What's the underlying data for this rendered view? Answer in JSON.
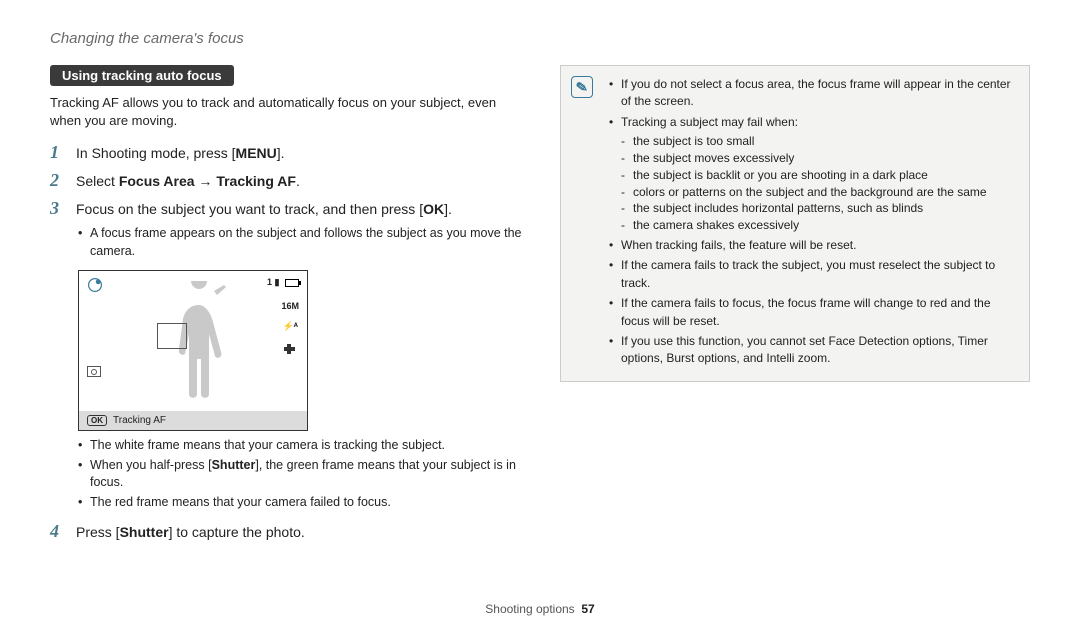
{
  "header": "Changing the camera's focus",
  "section_badge": "Using tracking auto focus",
  "intro": "Tracking AF allows you to track and automatically focus on your subject, even when you are moving.",
  "steps": {
    "s1": {
      "num": "1",
      "pre": "In Shooting mode, press [",
      "btn": "MENU",
      "post": "]."
    },
    "s2": {
      "num": "2",
      "pre": "Select ",
      "bold1": "Focus Area",
      "arrow": " → ",
      "bold2": "Tracking AF",
      "post": "."
    },
    "s3": {
      "num": "3",
      "pre": "Focus on the subject you want to track, and then press [",
      "btn": "OK",
      "post": "].",
      "sub": "A focus frame appears on the subject and follows the subject as you move the camera."
    },
    "s4": {
      "num": "4",
      "pre": "Press [",
      "bold": "Shutter",
      "post": "] to capture the photo."
    }
  },
  "lcd": {
    "counter": "1",
    "res": "16M",
    "flash": "⚡ᴬ",
    "bar_label": "Tracking AF",
    "bar_btn": "OK"
  },
  "frames": {
    "f1": "The white frame means that your camera is tracking the subject.",
    "f2_pre": "When you half-press [",
    "f2_bold": "Shutter",
    "f2_post": "], the green frame means that your subject is in focus.",
    "f3": "The red frame means that your camera failed to focus."
  },
  "note": {
    "n1": "If you do not select a focus area, the focus frame will appear in the center of the screen.",
    "n2": "Tracking a subject may fail when:",
    "n2subs": [
      "the subject is too small",
      "the subject moves excessively",
      "the subject is backlit or you are shooting in a dark place",
      "colors or patterns on the subject and the background are the same",
      "the subject includes horizontal patterns, such as blinds",
      "the camera shakes excessively"
    ],
    "n3": "When tracking fails, the feature will be reset.",
    "n4": "If the camera fails to track the subject, you must reselect the subject to track.",
    "n5": "If the camera fails to focus, the focus frame will change to red and the focus will be reset.",
    "n6": "If you use this function, you cannot set Face Detection options, Timer options, Burst options, and Intelli zoom."
  },
  "footer": {
    "section": "Shooting options",
    "page": "57"
  }
}
